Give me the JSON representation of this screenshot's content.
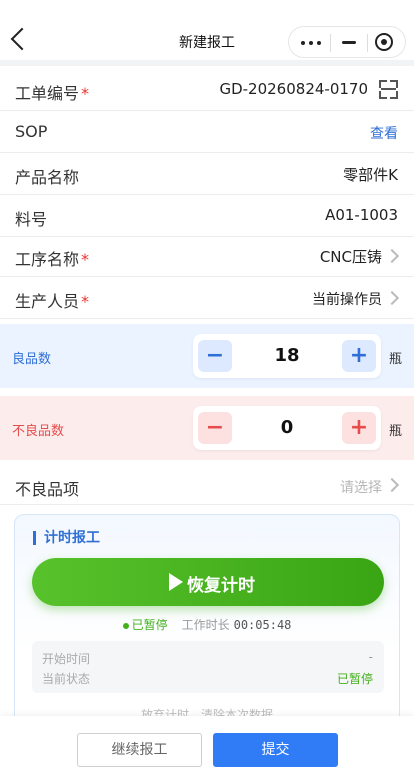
{
  "nav": {
    "title": "新建报工"
  },
  "form": {
    "work_order": {
      "label": "工单编号",
      "required": "*",
      "value": "GD-20260824-0170"
    },
    "sop": {
      "label": "SOP",
      "value": "查看"
    },
    "product_name": {
      "label": "产品名称",
      "value": "零部件K"
    },
    "part_no": {
      "label": "料号",
      "value": "A01-1003"
    },
    "process_name": {
      "label": "工序名称",
      "required": "*",
      "value": "CNC压铸"
    },
    "operator": {
      "label": "生产人员",
      "required": "*",
      "value": "当前操作员"
    },
    "good_qty": {
      "label": "良品数",
      "value": "18",
      "unit": "瓶",
      "minus": "−",
      "plus": "+"
    },
    "bad_qty": {
      "label": "不良品数",
      "value": "0",
      "unit": "瓶",
      "minus": "−",
      "plus": "+"
    },
    "defect_item": {
      "label": "不良品项",
      "placeholder": "请选择"
    }
  },
  "timer": {
    "title": "计时报工",
    "resume_label": "恢复计时",
    "status": "已暂停",
    "work_time_label": "工作时长",
    "work_time": "00:05:48",
    "start_time_label": "开始时间",
    "start_time_value": "-",
    "current_status_label": "当前状态",
    "current_status_value": "已暂停",
    "discard_text": "放弃计时，清除本次数据"
  },
  "footer": {
    "continue_label": "继续报工",
    "submit_label": "提交"
  },
  "colors": {
    "primary": "#2f7cf6",
    "green": "#44b01c",
    "danger": "#e64c4c"
  },
  "icons": [
    "back-icon",
    "more-icon",
    "minimize-icon",
    "target-icon",
    "scan-icon",
    "chevron-right-icon",
    "play-icon"
  ]
}
